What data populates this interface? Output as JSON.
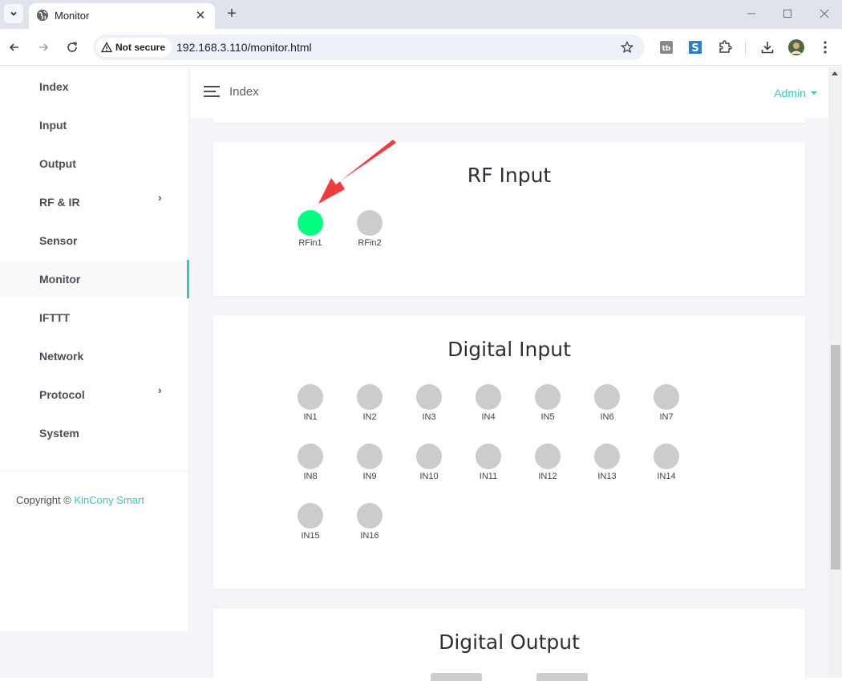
{
  "browser": {
    "tab_title": "Monitor",
    "security_label": "Not secure",
    "url": "192.168.3.110/monitor.html"
  },
  "sidebar": {
    "items": [
      {
        "label": "Index",
        "has_submenu": false
      },
      {
        "label": "Input",
        "has_submenu": false
      },
      {
        "label": "Output",
        "has_submenu": false
      },
      {
        "label": "RF & IR",
        "has_submenu": true
      },
      {
        "label": "Sensor",
        "has_submenu": false
      },
      {
        "label": "Monitor",
        "has_submenu": false,
        "active": true
      },
      {
        "label": "IFTTT",
        "has_submenu": false
      },
      {
        "label": "Network",
        "has_submenu": false
      },
      {
        "label": "Protocol",
        "has_submenu": true
      },
      {
        "label": "System",
        "has_submenu": false
      }
    ],
    "copyright_prefix": "Copyright ©",
    "copyright_brand": "KinCony Smart"
  },
  "header": {
    "title": "Index",
    "user": "Admin"
  },
  "colors": {
    "accent": "#35c9b5",
    "indicator_on": "#00ff80",
    "indicator_off": "#cccccc",
    "annotation": "#f03c3c"
  },
  "rf_input": {
    "title": "RF Input",
    "channels": [
      {
        "label": "RFin1",
        "on": true
      },
      {
        "label": "RFin2",
        "on": false
      }
    ]
  },
  "digital_input": {
    "title": "Digital Input",
    "channels": [
      {
        "label": "IN1",
        "on": false
      },
      {
        "label": "IN2",
        "on": false
      },
      {
        "label": "IN3",
        "on": false
      },
      {
        "label": "IN4",
        "on": false
      },
      {
        "label": "IN5",
        "on": false
      },
      {
        "label": "IN6",
        "on": false
      },
      {
        "label": "IN7",
        "on": false
      },
      {
        "label": "IN8",
        "on": false
      },
      {
        "label": "IN9",
        "on": false
      },
      {
        "label": "IN10",
        "on": false
      },
      {
        "label": "IN11",
        "on": false
      },
      {
        "label": "IN12",
        "on": false
      },
      {
        "label": "IN13",
        "on": false
      },
      {
        "label": "IN14",
        "on": false
      },
      {
        "label": "IN15",
        "on": false
      },
      {
        "label": "IN16",
        "on": false
      }
    ]
  },
  "digital_output": {
    "title": "Digital Output"
  }
}
